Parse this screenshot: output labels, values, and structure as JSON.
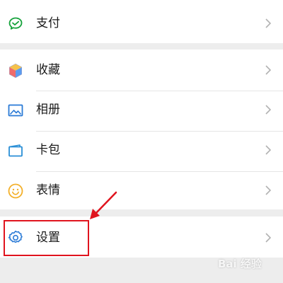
{
  "menu": {
    "items": [
      {
        "label": "支付",
        "icon": "wechat-pay-icon",
        "color": "#15a23b"
      },
      {
        "label": "收藏",
        "icon": "favorites-cube-icon",
        "color": "#f0a020"
      },
      {
        "label": "相册",
        "icon": "album-image-icon",
        "color": "#2a7ad6"
      },
      {
        "label": "卡包",
        "icon": "card-wallet-icon",
        "color": "#2a8fd6"
      },
      {
        "label": "表情",
        "icon": "emoji-smile-icon",
        "color": "#f3b02a"
      },
      {
        "label": "设置",
        "icon": "settings-gear-icon",
        "color": "#2a7ad6"
      }
    ]
  },
  "annotation": {
    "highlight_color": "#e0141e",
    "highlighted_item": "设置"
  },
  "watermark": {
    "text": "Bai 经验"
  }
}
